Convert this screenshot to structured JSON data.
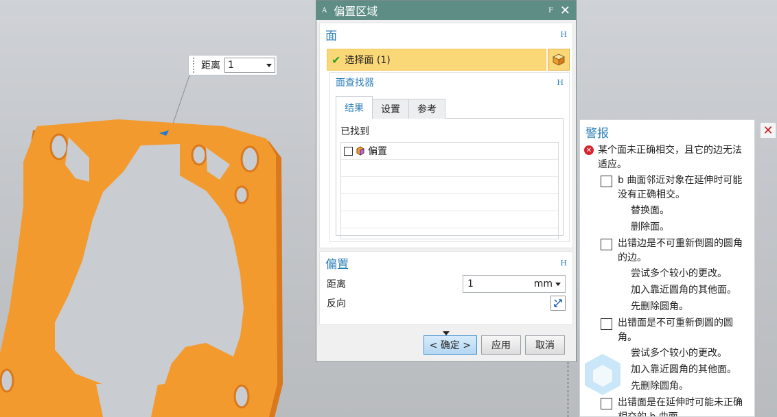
{
  "float_widget": {
    "label": "距离",
    "value": "1"
  },
  "dialog": {
    "title": "偏置区域",
    "title_left_mark": "A",
    "title_right_mark": "F",
    "face_group": {
      "title": "面",
      "collapse_mark": "H",
      "select_label": "选择面 (1)",
      "finder": {
        "title": "面查找器",
        "collapse_mark": "H",
        "tabs": [
          "结果",
          "设置",
          "参考"
        ],
        "found_label": "已找到",
        "items": [
          "偏置"
        ]
      }
    },
    "offset_group": {
      "title": "偏置",
      "collapse_mark": "H",
      "distance_label": "距离",
      "distance_value": "1",
      "unit": "mm",
      "reverse_label": "反向"
    },
    "buttons": {
      "ok": "< 确定 >",
      "apply": "应用",
      "cancel": "取消"
    }
  },
  "alert": {
    "title": "警报",
    "error": "某个面未正确相交，且它的边无法适应。",
    "issues": [
      {
        "text": "b 曲面邻近对象在延伸时可能没有正确相交。",
        "fixes": [
          "替换面。",
          "删除面。"
        ]
      },
      {
        "text": "出错边是不可重新倒圆的圆角的边。",
        "fixes": [
          "尝试多个较小的更改。",
          "加入靠近圆角的其他面。",
          "先删除圆角。"
        ]
      },
      {
        "text": "出错面是不可重新倒圆的圆角。",
        "fixes": [
          "尝试多个较小的更改。",
          "加入靠近圆角的其他面。",
          "先删除圆角。"
        ]
      },
      {
        "text": "出错面是在延伸时可能未正确相交的 b 曲面。",
        "fixes": []
      }
    ]
  },
  "colors": {
    "titlebar": "#5e8d86",
    "accent": "#2d7fb8",
    "selection": "#fbd877",
    "part": "#f39a2f",
    "error": "#d9232d"
  }
}
